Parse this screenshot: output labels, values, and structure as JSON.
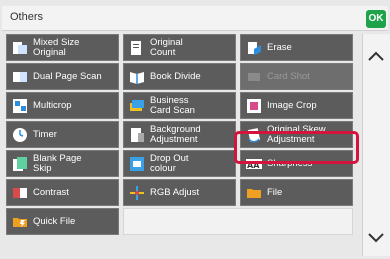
{
  "header": {
    "title": "Others",
    "ok_label": "OK"
  },
  "colors": {
    "ok": "#1fa34a",
    "highlight": "#d4143c",
    "cell": "#5c5c5c"
  },
  "grid": [
    {
      "label": "Mixed Size\nOriginal",
      "icon": "mixed-size-icon",
      "disabled": false
    },
    {
      "label": "Original\nCount",
      "icon": "original-count-icon",
      "disabled": false
    },
    {
      "label": "Erase",
      "icon": "erase-icon",
      "disabled": false
    },
    {
      "label": "Dual Page Scan",
      "icon": "dual-page-icon",
      "disabled": false
    },
    {
      "label": "Book Divide",
      "icon": "book-divide-icon",
      "disabled": false
    },
    {
      "label": "Card Shot",
      "icon": "card-shot-icon",
      "disabled": true
    },
    {
      "label": "Multicrop",
      "icon": "multicrop-icon",
      "disabled": false
    },
    {
      "label": "Business\nCard Scan",
      "icon": "business-card-icon",
      "disabled": false
    },
    {
      "label": "Image Crop",
      "icon": "image-crop-icon",
      "disabled": false
    },
    {
      "label": "Timer",
      "icon": "timer-icon",
      "disabled": false
    },
    {
      "label": "Background\nAdjustment",
      "icon": "background-adjust-icon",
      "disabled": false
    },
    {
      "label": "Original Skew\nAdjustment",
      "icon": "skew-adjust-icon",
      "disabled": false
    },
    {
      "label": "Blank Page\nSkip",
      "icon": "blank-page-icon",
      "disabled": false
    },
    {
      "label": "Drop Out\ncolour",
      "icon": "drop-out-icon",
      "disabled": false
    },
    {
      "label": "Sharpness",
      "icon": "sharpness-icon",
      "disabled": false
    },
    {
      "label": "Contrast",
      "icon": "contrast-icon",
      "disabled": false
    },
    {
      "label": "RGB Adjust",
      "icon": "rgb-adjust-icon",
      "disabled": false
    },
    {
      "label": "File",
      "icon": "file-icon",
      "disabled": false
    },
    {
      "label": "Quick File",
      "icon": "quick-file-icon",
      "disabled": false
    }
  ]
}
